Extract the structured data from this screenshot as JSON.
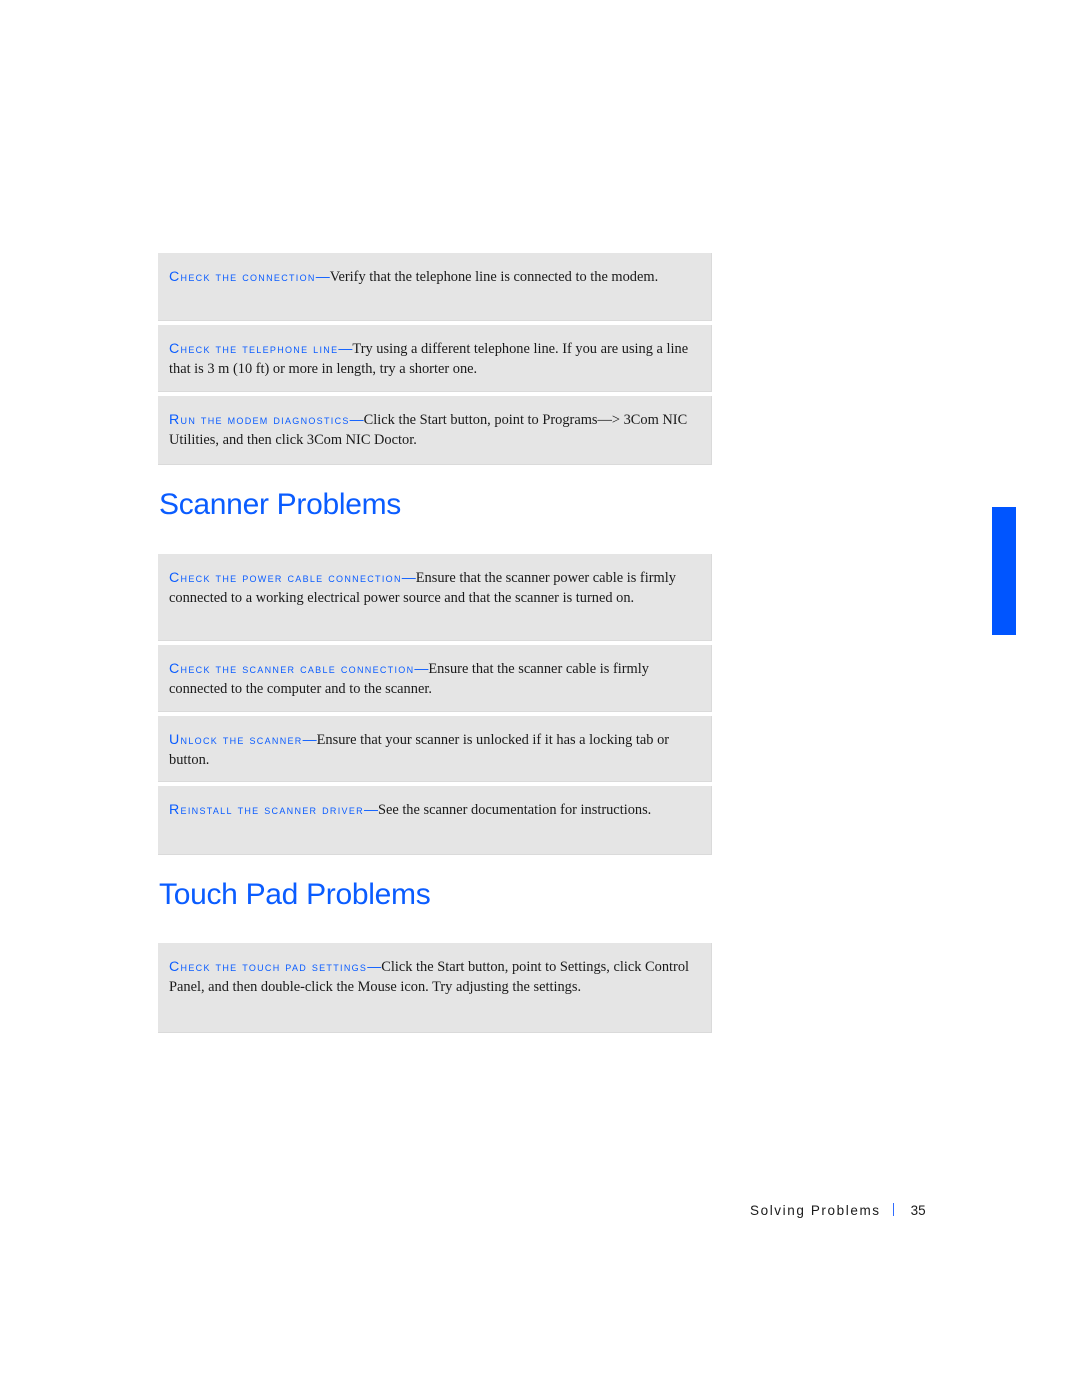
{
  "sections": [
    {
      "heading": null,
      "items": [
        {
          "lead": "Check the connection",
          "text": "Verify that the telephone line is connected to the modem."
        },
        {
          "lead": "Check the telephone line",
          "text": "Try using a different telephone line. If you are using a line that is 3 m (10 ft) or more in length, try a shorter one."
        },
        {
          "lead": "Run the modem diagnostics",
          "text": "Click the Start button, point to Programs—>  3Com NIC Utilities, and then click 3Com NIC Doctor."
        }
      ]
    },
    {
      "heading": "Scanner Problems",
      "items": [
        {
          "lead": "Check the power cable connection",
          "text": "Ensure that the scanner power cable is firmly connected to a working electrical power source and that the scanner is turned on."
        },
        {
          "lead": "Check the scanner cable connection",
          "text": "Ensure that the scanner cable is firmly connected to the computer and to the scanner."
        },
        {
          "lead": "Unlock the scanner",
          "text": "Ensure that your scanner is unlocked if it has a locking tab or button."
        },
        {
          "lead": "Reinstall the scanner driver",
          "text": "See the scanner documentation for instructions."
        }
      ]
    },
    {
      "heading": "Touch Pad Problems",
      "items": [
        {
          "lead": "Check the touch pad settings",
          "text": "Click the Start button, point to Settings, click Control Panel, and then double-click the Mouse icon. Try adjusting the settings."
        }
      ]
    }
  ],
  "lead_separator": "—",
  "footer": {
    "section_title": "Solving Problems",
    "page_number": "35"
  },
  "colors": {
    "accent": "#0a5cff",
    "tab": "#0055ff",
    "box_background": "#e5e5e5"
  }
}
